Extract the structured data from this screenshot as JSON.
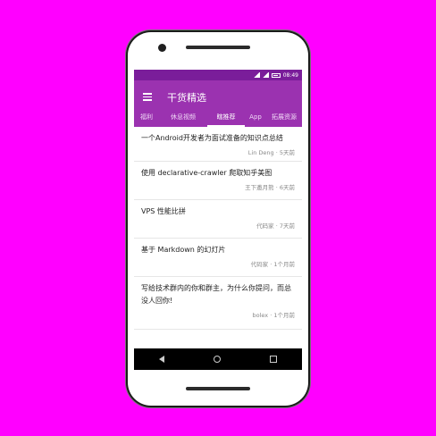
{
  "status_bar": {
    "time": "08:49"
  },
  "app_bar": {
    "title": "干货精选",
    "menu_icon": "menu-icon"
  },
  "tabs": [
    {
      "label": "福利"
    },
    {
      "label": "休息视频"
    },
    {
      "label": "瞎推荐"
    },
    {
      "label": "App"
    },
    {
      "label": "拓展资源"
    }
  ],
  "active_tab": "瞎推荐",
  "list": [
    {
      "title": "一个Android开发者为面试准备的知识点总结",
      "meta": "Lin Deng · 5天前"
    },
    {
      "title": "使用 declarative-crawler 爬取知乎美图",
      "meta": "王下邀月熊 · 6天前"
    },
    {
      "title": "VPS 性能比拼",
      "meta": "代码家 · 7天前"
    },
    {
      "title": "基于 Markdown 的幻灯片",
      "meta": "代码家 · 1个月前"
    },
    {
      "title": "写给技术群内的你和群主，为什么你提问，而总没人回你!",
      "meta": "bolex · 1个月前"
    }
  ],
  "colors": {
    "status_bar": "#7a1d9a",
    "app_bar": "#9b32b0",
    "background": "#ff00ff"
  }
}
